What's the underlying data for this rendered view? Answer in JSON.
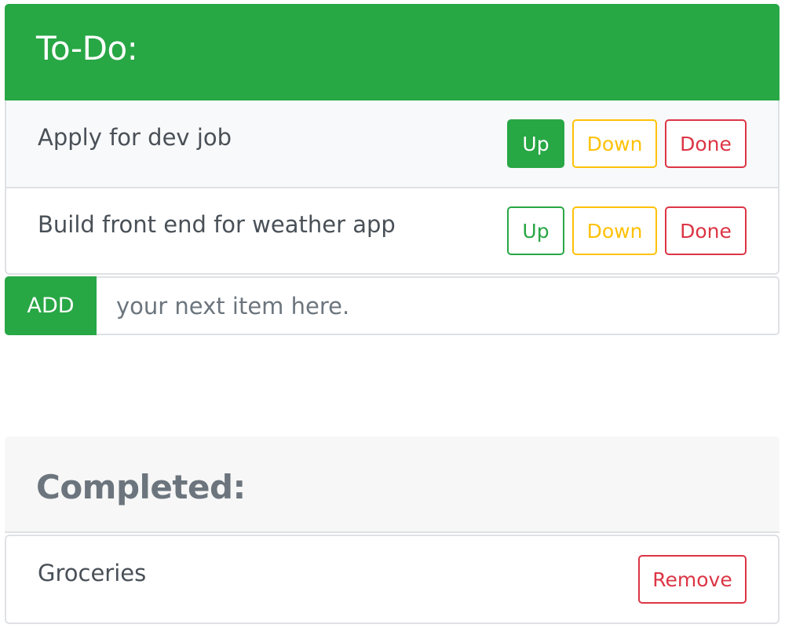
{
  "todo": {
    "title": "To-Do:",
    "items": [
      {
        "text": "Apply for dev job"
      },
      {
        "text": "Build front end for weather app"
      }
    ],
    "buttons": {
      "up": "Up",
      "down": "Down",
      "done": "Done"
    },
    "add": {
      "button_label": "ADD",
      "placeholder": "your next item here."
    }
  },
  "completed": {
    "title": "Completed:",
    "items": [
      {
        "text": "Groceries"
      }
    ],
    "remove_label": "Remove"
  },
  "colors": {
    "success": "#28a745",
    "warning": "#ffc107",
    "danger": "#dc3545",
    "muted": "#6c757d"
  }
}
